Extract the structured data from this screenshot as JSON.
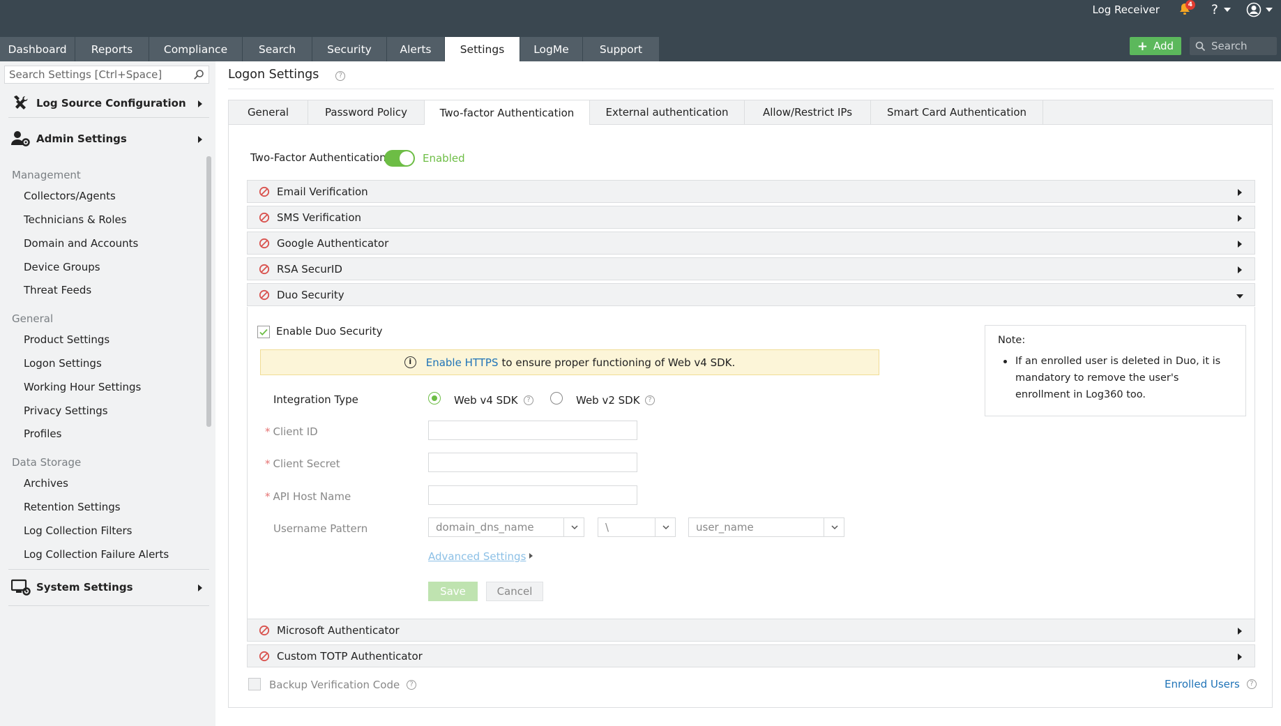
{
  "header": {
    "log_receiver": "Log Receiver",
    "notification_count": "4",
    "help": "?",
    "add_label": "Add",
    "search_placeholder": "Search"
  },
  "tabs": [
    "Dashboard",
    "Reports",
    "Compliance",
    "Search",
    "Security",
    "Alerts",
    "Settings",
    "LogMe",
    "Support"
  ],
  "active_tab": "Settings",
  "sidebar": {
    "search_placeholder": "Search Settings [Ctrl+Space]",
    "log_source_config": "Log Source Configuration",
    "admin_settings": "Admin Settings",
    "system_settings": "System Settings",
    "groups": {
      "management": {
        "label": "Management",
        "items": [
          "Collectors/Agents",
          "Technicians & Roles",
          "Domain and Accounts",
          "Device Groups",
          "Threat Feeds"
        ]
      },
      "general": {
        "label": "General",
        "items": [
          "Product Settings",
          "Logon Settings",
          "Working Hour Settings",
          "Privacy Settings",
          "Profiles"
        ]
      },
      "data_storage": {
        "label": "Data Storage",
        "items": [
          "Archives",
          "Retention Settings",
          "Log Collection Filters",
          "Log Collection Failure Alerts"
        ]
      }
    }
  },
  "page": {
    "title": "Logon Settings",
    "subtabs": [
      "General",
      "Password Policy",
      "Two-factor Authentication",
      "External authentication",
      "Allow/Restrict IPs",
      "Smart Card Authentication"
    ],
    "active_subtab": "Two-factor Authentication",
    "tfa_label": "Two-Factor Authentication",
    "tfa_status": "Enabled",
    "methods": {
      "email": "Email Verification",
      "sms": "SMS Verification",
      "google": "Google Authenticator",
      "rsa": "RSA SecurID",
      "duo": "Duo Security",
      "microsoft": "Microsoft Authenticator",
      "totp": "Custom TOTP Authenticator"
    },
    "duo": {
      "enable_label": "Enable Duo Security",
      "enabled_checked": true,
      "notice_link": "Enable HTTPS",
      "notice_text": "to ensure proper functioning of Web v4 SDK.",
      "integration_type_label": "Integration Type",
      "option_v4": "Web v4 SDK",
      "option_v2": "Web v2 SDK",
      "selected_option": "Web v4 SDK",
      "client_id_label": "Client ID",
      "client_secret_label": "Client Secret",
      "api_host_label": "API Host Name",
      "required_mark": "*",
      "username_pattern_label": "Username Pattern",
      "pattern_domain": "domain_dns_name",
      "pattern_separator": "\\",
      "pattern_user": "user_name",
      "advanced_settings": "Advanced Settings",
      "save": "Save",
      "cancel": "Cancel",
      "client_id_value": "",
      "client_secret_value": "",
      "api_host_value": ""
    },
    "note": {
      "title": "Note:",
      "text": "If an enrolled user is deleted in Duo, it is mandatory to remove the user's enrollment in Log360 too."
    },
    "backup_code_label": "Backup Verification Code",
    "enrolled_users": "Enrolled Users"
  },
  "colors": {
    "topbar": "#3a4750",
    "tab_inactive": "#525e67",
    "accent_green": "#6dbd45",
    "link_blue": "#1f73b7",
    "disabled_icon_red": "#d9534f"
  }
}
